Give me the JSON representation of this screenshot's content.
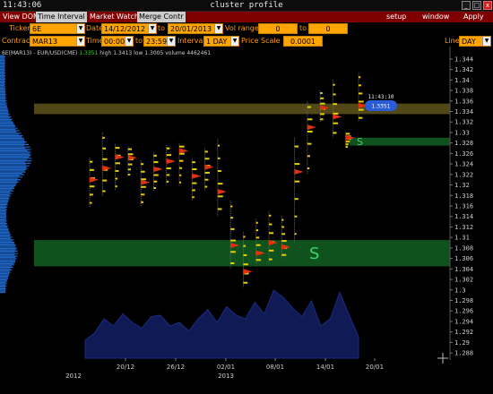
{
  "window": {
    "clock": "11:43:06",
    "title": "cluster profile",
    "minimize_label": "_",
    "maximize_label": "□",
    "close_label": "x"
  },
  "menu": {
    "tabs": [
      "View DOM",
      "Time Interval",
      "Market Watch",
      "Merge Contr"
    ],
    "setup": "setup",
    "window": "window",
    "apply": "Apply"
  },
  "controls": {
    "ticker_label": "Ticker",
    "ticker_value": "6E",
    "date_label": "Date",
    "date_from": "14/12/2012",
    "to_label": "to",
    "date_to": "20/01/2013",
    "vol_range_label": "Vol range",
    "vol_from": "0",
    "vol_to_label": "to",
    "vol_to": "0",
    "contract_label": "Contract",
    "contract_value": "MAR13",
    "time_label": "Time",
    "time_from": "00:00",
    "time_to_label": "to",
    "time_to": "23:59",
    "interval_label": "Interval",
    "interval_value": "1 DAY",
    "price_scale_label": "Price Scale",
    "price_scale_value": "0.0001",
    "line_label": "Line",
    "line_value": "DAY"
  },
  "info": {
    "symbol": "6E(MAR13) - EUR/USD(CME)",
    "last": "1.3351",
    "high_text": "high 1.3413",
    "low_text": "low 1.3005",
    "volume_text": "volume 4462461"
  },
  "chart_data": {
    "type": "other",
    "y_ticks": [
      "1.344",
      "1.342",
      "1.34",
      "1.338",
      "1.336",
      "1.334",
      "1.332",
      "1.33",
      "1.328",
      "1.326",
      "1.324",
      "1.322",
      "1.32",
      "1.318",
      "1.316",
      "1.314",
      "1.312",
      "1.31",
      "1.308",
      "1.306",
      "1.304",
      "1.302",
      "1.3",
      "1.298",
      "1.296",
      "1.294",
      "1.292",
      "1.29",
      "1.288"
    ],
    "ylim": [
      1.287,
      1.345
    ],
    "x_ticks": [
      "20/12",
      "26/12",
      "02/01",
      "08/01",
      "14/01",
      "20/01"
    ],
    "year_labels": [
      "2012",
      "2013"
    ],
    "current_price_label": "1.3351",
    "current_time_label": "11:43:10",
    "zones": [
      {
        "type": "resistance",
        "from": 1.3335,
        "to": 1.3355
      },
      {
        "type": "support",
        "label": "S",
        "from": 1.3275,
        "to": 1.329
      },
      {
        "type": "support",
        "label": "S",
        "from": 1.3045,
        "to": 1.3095
      }
    ],
    "days": [
      {
        "date": "17/12",
        "low": 1.3158,
        "high": 1.3252,
        "poc": 1.321
      },
      {
        "date": "18/12",
        "low": 1.3178,
        "high": 1.33,
        "poc": 1.3232
      },
      {
        "date": "19/12",
        "low": 1.319,
        "high": 1.3278,
        "poc": 1.3253
      },
      {
        "date": "20/12",
        "low": 1.3215,
        "high": 1.3273,
        "poc": 1.3252
      },
      {
        "date": "21/12",
        "low": 1.316,
        "high": 1.3247,
        "poc": 1.3205
      },
      {
        "date": "24/12",
        "low": 1.3188,
        "high": 1.3262,
        "poc": 1.323
      },
      {
        "date": "26/12",
        "low": 1.32,
        "high": 1.3276,
        "poc": 1.3245
      },
      {
        "date": "27/12",
        "low": 1.3198,
        "high": 1.328,
        "poc": 1.3265
      },
      {
        "date": "28/12",
        "low": 1.317,
        "high": 1.325,
        "poc": 1.3217
      },
      {
        "date": "31/12",
        "low": 1.319,
        "high": 1.327,
        "poc": 1.3234
      },
      {
        "date": "02/01",
        "low": 1.3142,
        "high": 1.3287,
        "poc": 1.3187
      },
      {
        "date": "03/01",
        "low": 1.304,
        "high": 1.317,
        "poc": 1.3085
      },
      {
        "date": "04/01",
        "low": 1.3005,
        "high": 1.311,
        "poc": 1.3035
      },
      {
        "date": "07/01",
        "low": 1.305,
        "high": 1.3135,
        "poc": 1.307
      },
      {
        "date": "08/01",
        "low": 1.305,
        "high": 1.315,
        "poc": 1.309
      },
      {
        "date": "09/01",
        "low": 1.306,
        "high": 1.314,
        "poc": 1.3082
      },
      {
        "date": "10/01",
        "low": 1.309,
        "high": 1.329,
        "poc": 1.3225
      },
      {
        "date": "11/01",
        "low": 1.322,
        "high": 1.336,
        "poc": 1.331
      },
      {
        "date": "14/01",
        "low": 1.332,
        "high": 1.338,
        "poc": 1.3347
      },
      {
        "date": "15/01",
        "low": 1.329,
        "high": 1.34,
        "poc": 1.333
      },
      {
        "date": "16/01",
        "low": 1.327,
        "high": 1.33,
        "poc": 1.329
      },
      {
        "date": "17/01",
        "low": 1.332,
        "high": 1.3413,
        "poc": 1.3351
      }
    ],
    "volume_mountain": [
      0.25,
      0.35,
      0.55,
      0.45,
      0.62,
      0.5,
      0.42,
      0.58,
      0.6,
      0.45,
      0.5,
      0.38,
      0.55,
      0.68,
      0.5,
      0.72,
      0.6,
      0.55,
      0.78,
      0.62,
      0.95,
      0.85,
      0.7,
      0.58,
      0.8,
      0.45,
      0.55,
      0.92,
      0.6,
      0.3
    ]
  }
}
